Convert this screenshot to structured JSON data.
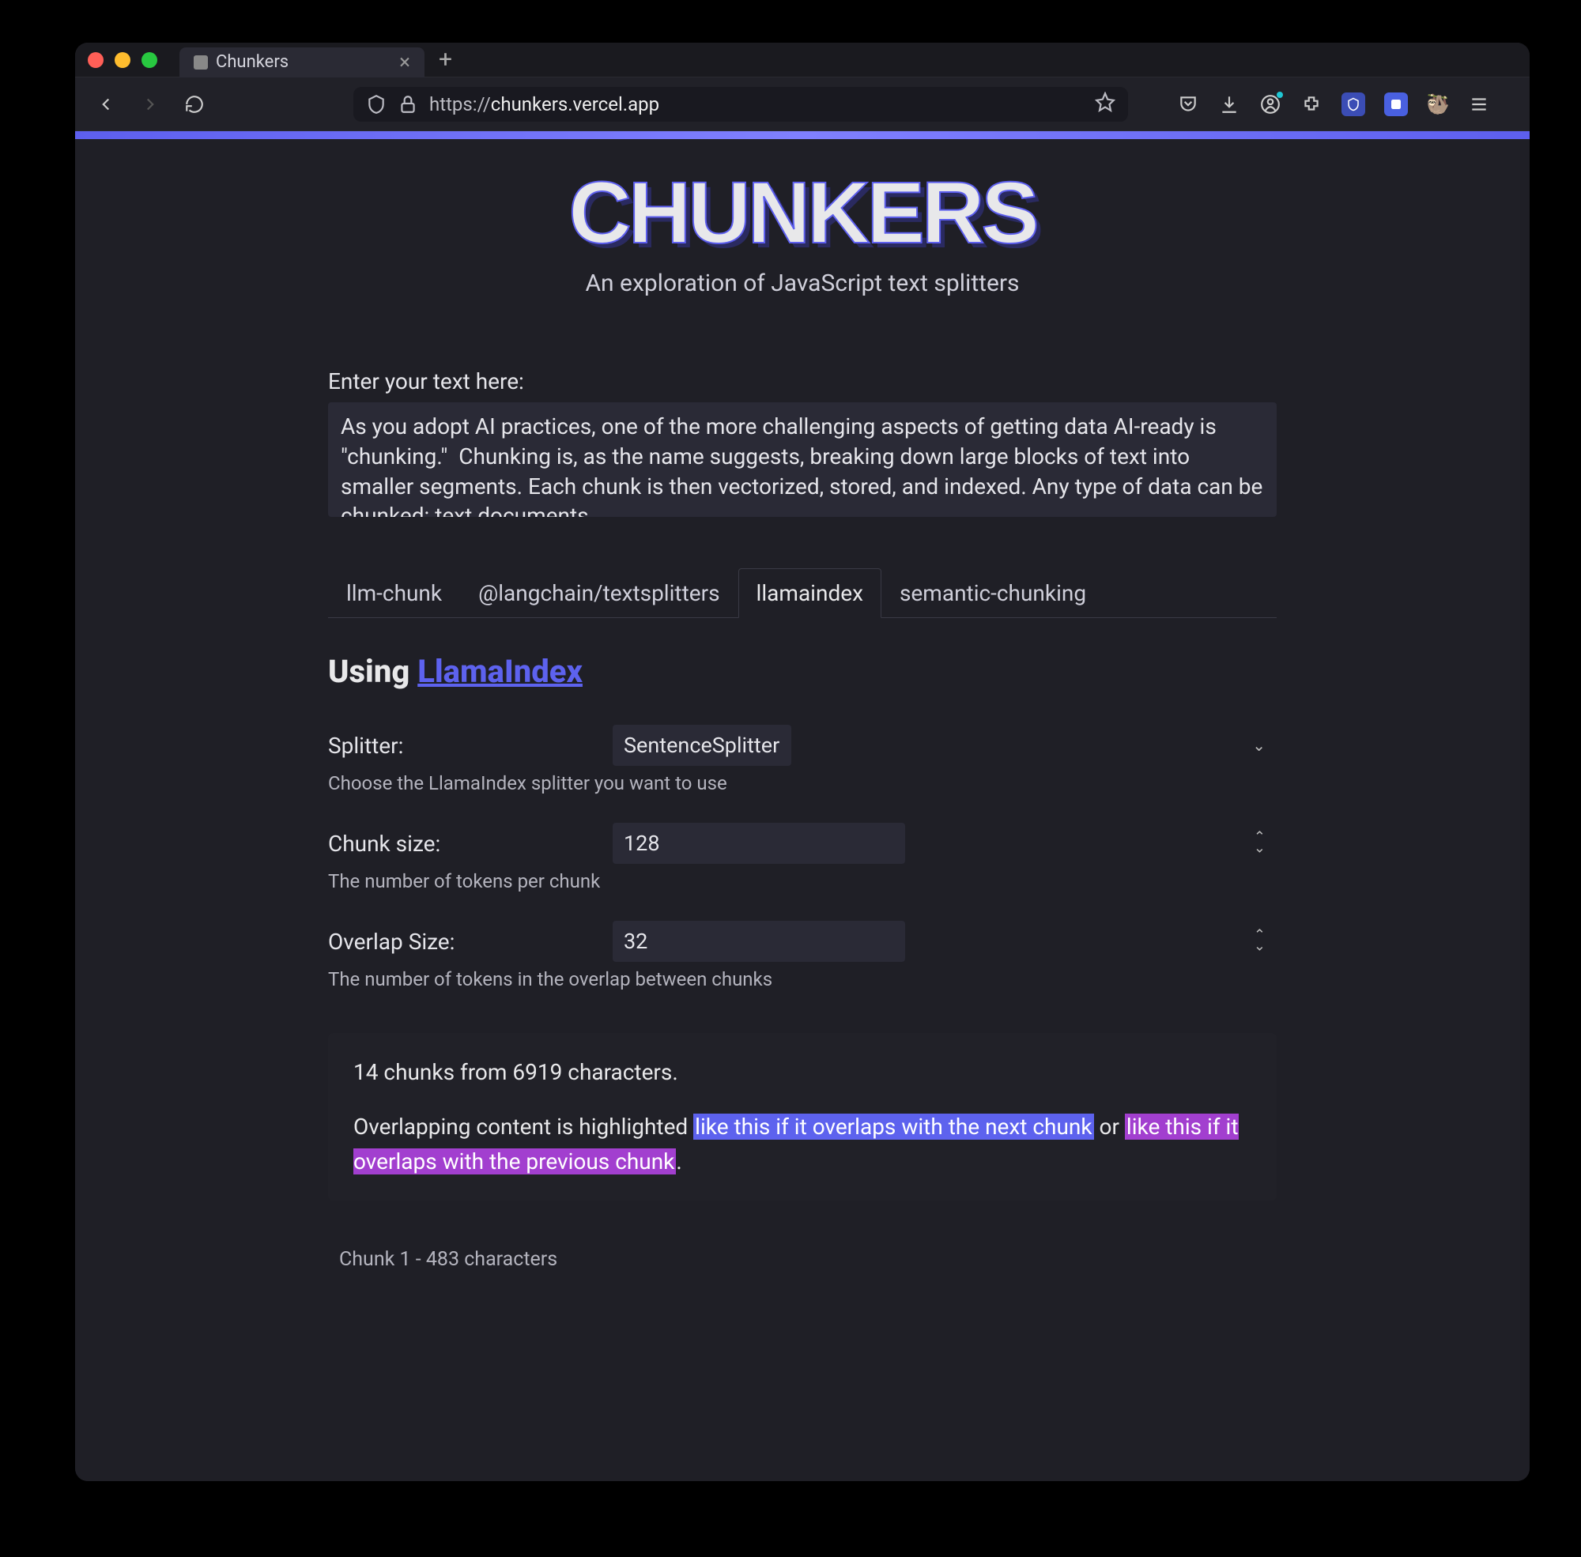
{
  "browser": {
    "tab_title": "Chunkers",
    "url_prefix": "https://",
    "url_domain": "chunkers.vercel.app"
  },
  "page": {
    "logo_text": "CHUNKERS",
    "subtitle": "An exploration of JavaScript text splitters",
    "textarea_label": "Enter your text here:",
    "textarea_value": "As you adopt AI practices, one of the more challenging aspects of getting data AI-ready is \"chunking.\"  Chunking is, as the name suggests, breaking down large blocks of text into smaller segments. Each chunk is then vectorized, stored, and indexed. Any type of data can be chunked: text documents,",
    "tabs": [
      {
        "label": "llm-chunk",
        "active": false
      },
      {
        "label": "@langchain/textsplitters",
        "active": false
      },
      {
        "label": "llamaindex",
        "active": true
      },
      {
        "label": "semantic-chunking",
        "active": false
      }
    ],
    "heading_prefix": "Using ",
    "heading_link": "LlamaIndex",
    "splitter": {
      "label": "Splitter:",
      "value": "SentenceSplitter",
      "help": "Choose the LlamaIndex splitter you want to use"
    },
    "chunk_size": {
      "label": "Chunk size:",
      "value": "128",
      "help": "The number of tokens per chunk"
    },
    "overlap_size": {
      "label": "Overlap Size:",
      "value": "32",
      "help": "The number of tokens in the overlap between chunks"
    },
    "result": {
      "summary": "14 chunks from 6919 characters.",
      "overlap_prefix": "Overlapping content is highlighted ",
      "overlap_next": "like this if it overlaps with the next chunk",
      "overlap_mid": " or ",
      "overlap_prev": "like this if it overlaps with the previous chunk",
      "overlap_suffix": "."
    },
    "chunk_first_label": "Chunk 1 - 483 characters"
  },
  "colors": {
    "accent": "#5d62ee",
    "highlight_prev": "#a23fcf"
  }
}
